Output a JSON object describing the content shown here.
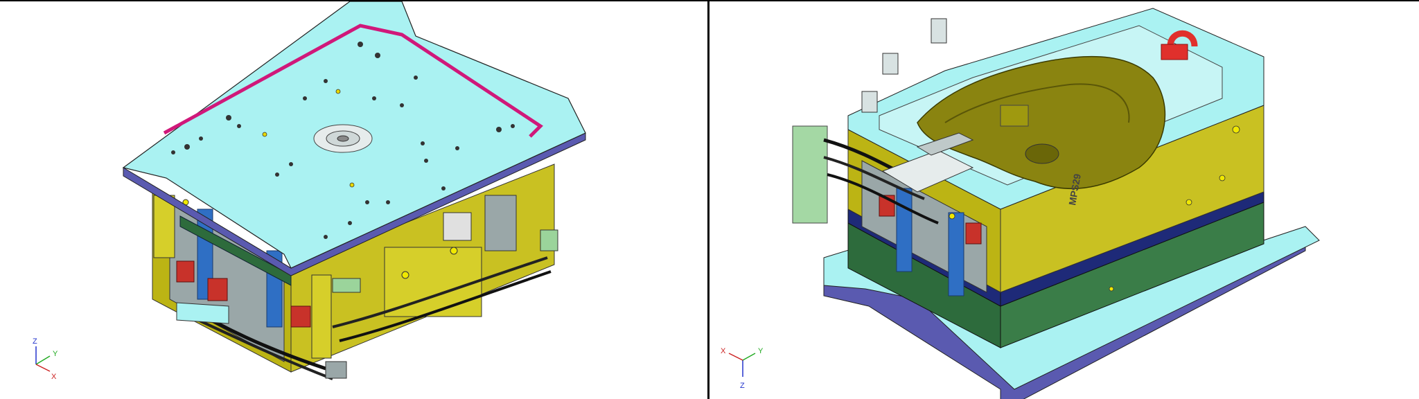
{
  "colors": {
    "plate": "#aaf2f2",
    "plate_side": "#7fc6cc",
    "base_blue": "#5a5ab0",
    "olive": "#bcb414",
    "green": "#2d6b3c",
    "pillar_blue": "#2f6fc4",
    "red": "#c8322a",
    "slot_magenta": "#d0187a",
    "part_olive": "#8a8410",
    "eye_bolt": "#e0302c"
  },
  "viewports": {
    "left": {
      "triad": {
        "z": "Z",
        "y": "Y",
        "x": "X"
      }
    },
    "right": {
      "triad": {
        "x": "X",
        "y": "Y",
        "z": "Z"
      },
      "engraving": "MPS29"
    }
  }
}
